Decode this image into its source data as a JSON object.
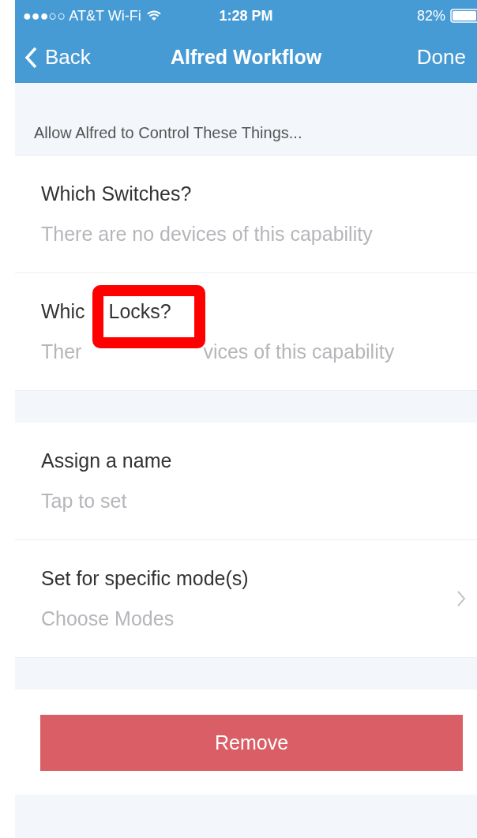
{
  "status_bar": {
    "carrier": "●●●○○ AT&T Wi-Fi",
    "time": "1:28 PM",
    "battery": "82%"
  },
  "nav_bar": {
    "back": "Back",
    "title": "Alfred Workflow",
    "done": "Done"
  },
  "sections": [
    {
      "header": "Allow Alfred to Control These Things...",
      "rows": [
        {
          "kind": "plain",
          "title": "Which Switches?",
          "subtitle": "There are no devices of this capability",
          "chevron": false
        },
        {
          "kind": "annotated",
          "title_parts": [
            "Whic",
            "Locks?"
          ],
          "subtitle_parts": [
            "Ther",
            "vices of this capability"
          ],
          "chevron": false
        }
      ]
    },
    {
      "rows": [
        {
          "kind": "plain",
          "title": "Assign a name",
          "subtitle": "Tap to set",
          "chevron": false
        },
        {
          "kind": "plain",
          "title": "Set for specific mode(s)",
          "subtitle": "Choose Modes",
          "chevron": true
        }
      ]
    }
  ],
  "remove_button": "Remove"
}
